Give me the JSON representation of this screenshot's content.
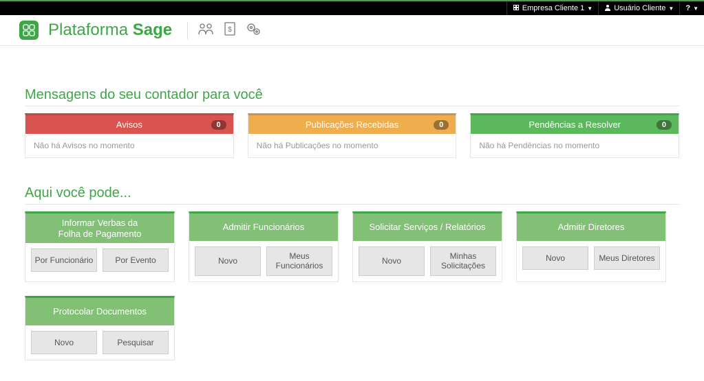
{
  "topbar": {
    "company": "Empresa Cliente 1",
    "user": "Usuário Cliente",
    "help": "?"
  },
  "brand": {
    "word1": "Plataforma",
    "word2": "Sage"
  },
  "sections": {
    "messages_title": "Mensagens do seu contador para você",
    "actions_title": "Aqui você pode..."
  },
  "messages": {
    "avisos": {
      "title": "Avisos",
      "count": "0",
      "empty": "Não há Avisos no momento"
    },
    "publicacoes": {
      "title": "Publicações Recebidas",
      "count": "0",
      "empty": "Não há Publicações no momento"
    },
    "pendencias": {
      "title": "Pendências a Resolver",
      "count": "0",
      "empty": "Não há Pendências no momento"
    }
  },
  "actions": {
    "verbas": {
      "title": "Informar Verbas da\nFolha de Pagamento",
      "btn1": "Por Funcionário",
      "btn2": "Por Evento"
    },
    "admitir_func": {
      "title": "Admitir Funcionários",
      "btn1": "Novo",
      "btn2": "Meus Funcionários"
    },
    "solicitar": {
      "title": "Solicitar Serviços / Relatórios",
      "btn1": "Novo",
      "btn2": "Minhas Solicitações"
    },
    "admitir_dir": {
      "title": "Admitir Diretores",
      "btn1": "Novo",
      "btn2": "Meus Diretores"
    },
    "protocolar": {
      "title": "Protocolar Documentos",
      "btn1": "Novo",
      "btn2": "Pesquisar"
    }
  }
}
